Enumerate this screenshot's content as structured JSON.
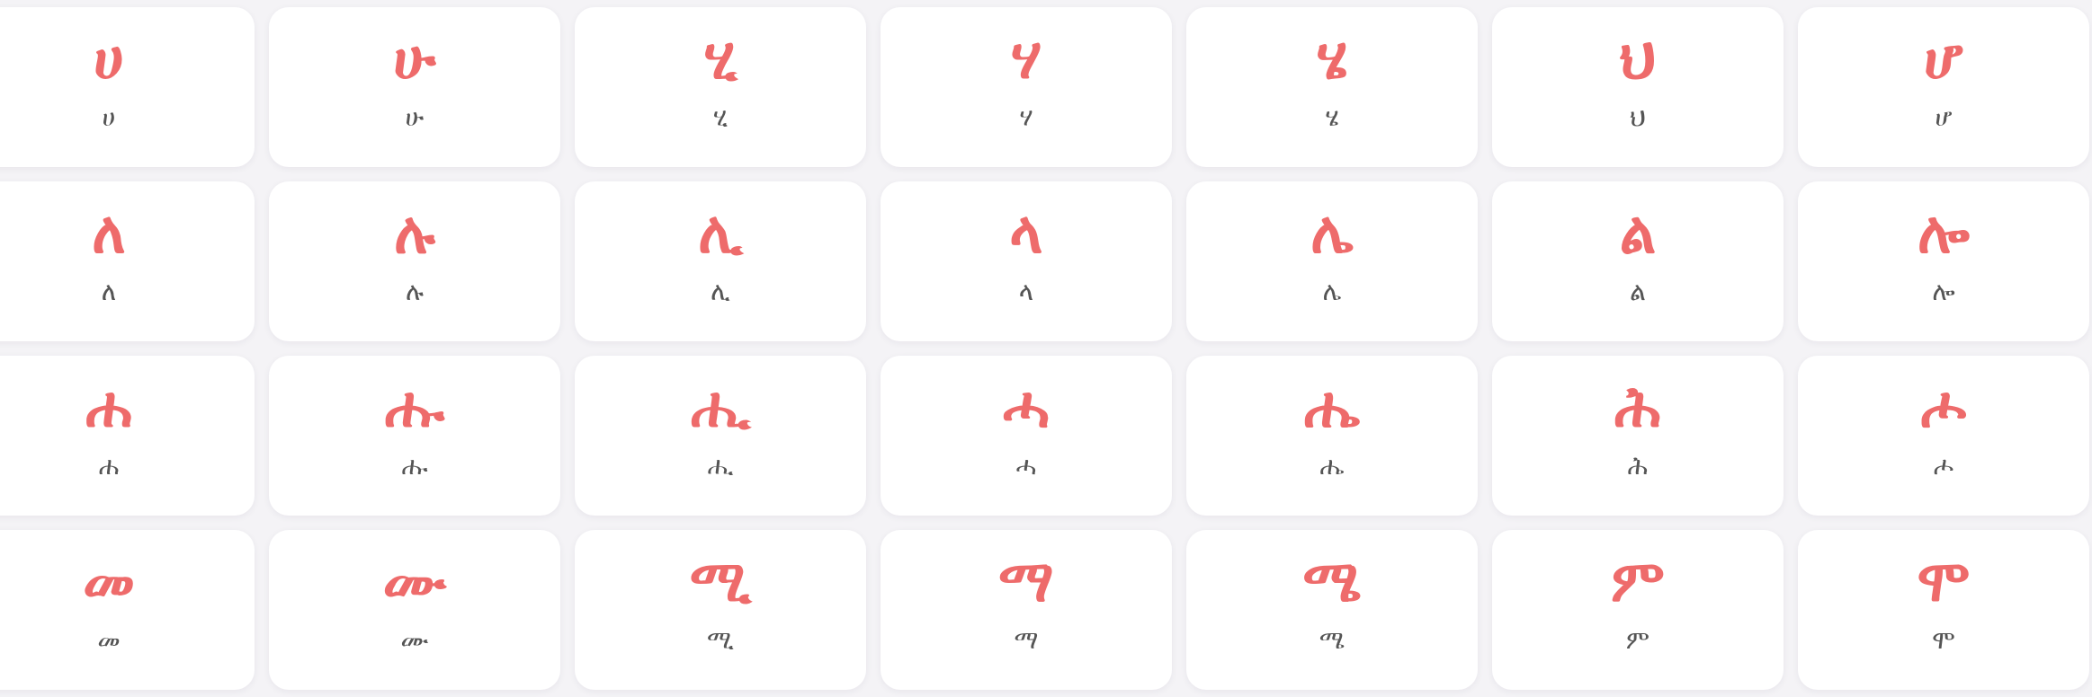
{
  "colors": {
    "accent": "#ee6b6b",
    "label": "#555555",
    "card_bg": "#ffffff",
    "page_bg": "#f4f3f6"
  },
  "rows": [
    {
      "family": "ha",
      "cards": [
        {
          "glyph": "ሀ",
          "label": "ሀ"
        },
        {
          "glyph": "ሁ",
          "label": "ሁ"
        },
        {
          "glyph": "ሂ",
          "label": "ሂ"
        },
        {
          "glyph": "ሃ",
          "label": "ሃ"
        },
        {
          "glyph": "ሄ",
          "label": "ሄ"
        },
        {
          "glyph": "ህ",
          "label": "ህ"
        },
        {
          "glyph": "ሆ",
          "label": "ሆ"
        }
      ]
    },
    {
      "family": "le",
      "cards": [
        {
          "glyph": "ለ",
          "label": "ለ"
        },
        {
          "glyph": "ሉ",
          "label": "ሉ"
        },
        {
          "glyph": "ሊ",
          "label": "ሊ"
        },
        {
          "glyph": "ላ",
          "label": "ላ"
        },
        {
          "glyph": "ሌ",
          "label": "ሌ"
        },
        {
          "glyph": "ል",
          "label": "ል"
        },
        {
          "glyph": "ሎ",
          "label": "ሎ"
        }
      ]
    },
    {
      "family": "hha",
      "cards": [
        {
          "glyph": "ሐ",
          "label": "ሐ"
        },
        {
          "glyph": "ሑ",
          "label": "ሑ"
        },
        {
          "glyph": "ሒ",
          "label": "ሒ"
        },
        {
          "glyph": "ሓ",
          "label": "ሓ"
        },
        {
          "glyph": "ሔ",
          "label": "ሔ"
        },
        {
          "glyph": "ሕ",
          "label": "ሕ"
        },
        {
          "glyph": "ሖ",
          "label": "ሖ"
        }
      ]
    },
    {
      "family": "me",
      "cards": [
        {
          "glyph": "መ",
          "label": "መ"
        },
        {
          "glyph": "ሙ",
          "label": "ሙ"
        },
        {
          "glyph": "ሚ",
          "label": "ሚ"
        },
        {
          "glyph": "ማ",
          "label": "ማ"
        },
        {
          "glyph": "ሜ",
          "label": "ሜ"
        },
        {
          "glyph": "ም",
          "label": "ም"
        },
        {
          "glyph": "ሞ",
          "label": "ሞ"
        }
      ]
    }
  ]
}
